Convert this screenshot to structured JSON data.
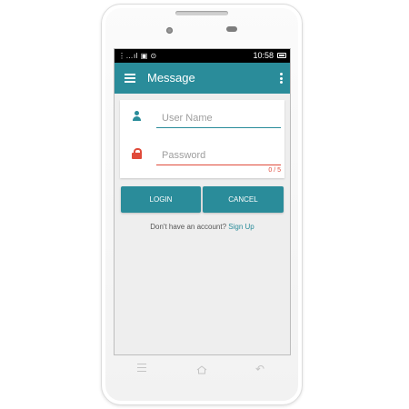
{
  "status_bar": {
    "icons": "⋮…ıl ▣ ⊙",
    "time": "10:58"
  },
  "app_bar": {
    "title": "Message"
  },
  "login_form": {
    "username_placeholder": "User Name",
    "password_placeholder": "Password",
    "password_counter": "0 / 5"
  },
  "buttons": {
    "login_label": "LOGIN",
    "cancel_label": "CANCEL"
  },
  "signup": {
    "prompt": "Don't have an account?",
    "link_label": "Sign Up"
  },
  "nav_keys": {
    "back_glyph": "↶"
  },
  "colors": {
    "accent": "#2a8c9a",
    "error": "#e04b3b",
    "background": "#eeeeee"
  },
  "icons": {
    "menu": "menu-icon",
    "overflow": "more-vert-icon",
    "user": "user-icon",
    "lock": "lock-icon",
    "battery": "battery-icon"
  }
}
